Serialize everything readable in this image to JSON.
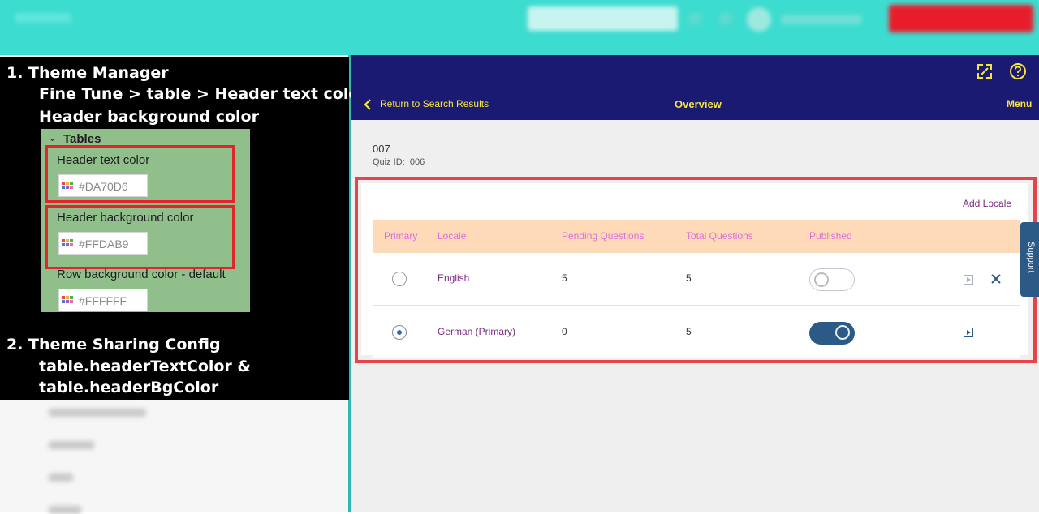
{
  "annotation": {
    "line1": "1.  Theme Manager",
    "line2": "Fine Tune >  table > Header text color &",
    "line3": "Header background color",
    "line4": "2. Theme Sharing Config",
    "line5": "table.headerTextColor &",
    "line6": "table.headerBgColor"
  },
  "theme_panel": {
    "section": "Tables",
    "header_text_color_label": "Header text color",
    "header_text_color_value": "#DA70D6",
    "header_bg_color_label": "Header background color",
    "header_bg_color_value": "#FFDAB9",
    "row_bg_color_label": "Row background color - default",
    "row_bg_color_value": "#FFFFFF"
  },
  "nav": {
    "back_label": "Return to Search Results",
    "title": "Overview",
    "menu_label": "Menu"
  },
  "quiz": {
    "title": "007",
    "id_label": "Quiz ID:",
    "id_value": "006"
  },
  "table": {
    "add_locale": "Add Locale",
    "columns": [
      "Primary",
      "Locale",
      "Pending Questions",
      "Total Questions",
      "Published"
    ],
    "rows": [
      {
        "primary": false,
        "locale": "English",
        "pending": "5",
        "total": "5",
        "published": false
      },
      {
        "primary": true,
        "locale": "German (Primary)",
        "pending": "0",
        "total": "5",
        "published": true
      }
    ]
  },
  "support_label": "Support",
  "colors": {
    "header_text": "#DA70D6",
    "header_bg": "#FFDAB9",
    "shell": "#1A1A72",
    "accent_yellow": "#F4E43C",
    "highlight_red": "#E8434A"
  }
}
